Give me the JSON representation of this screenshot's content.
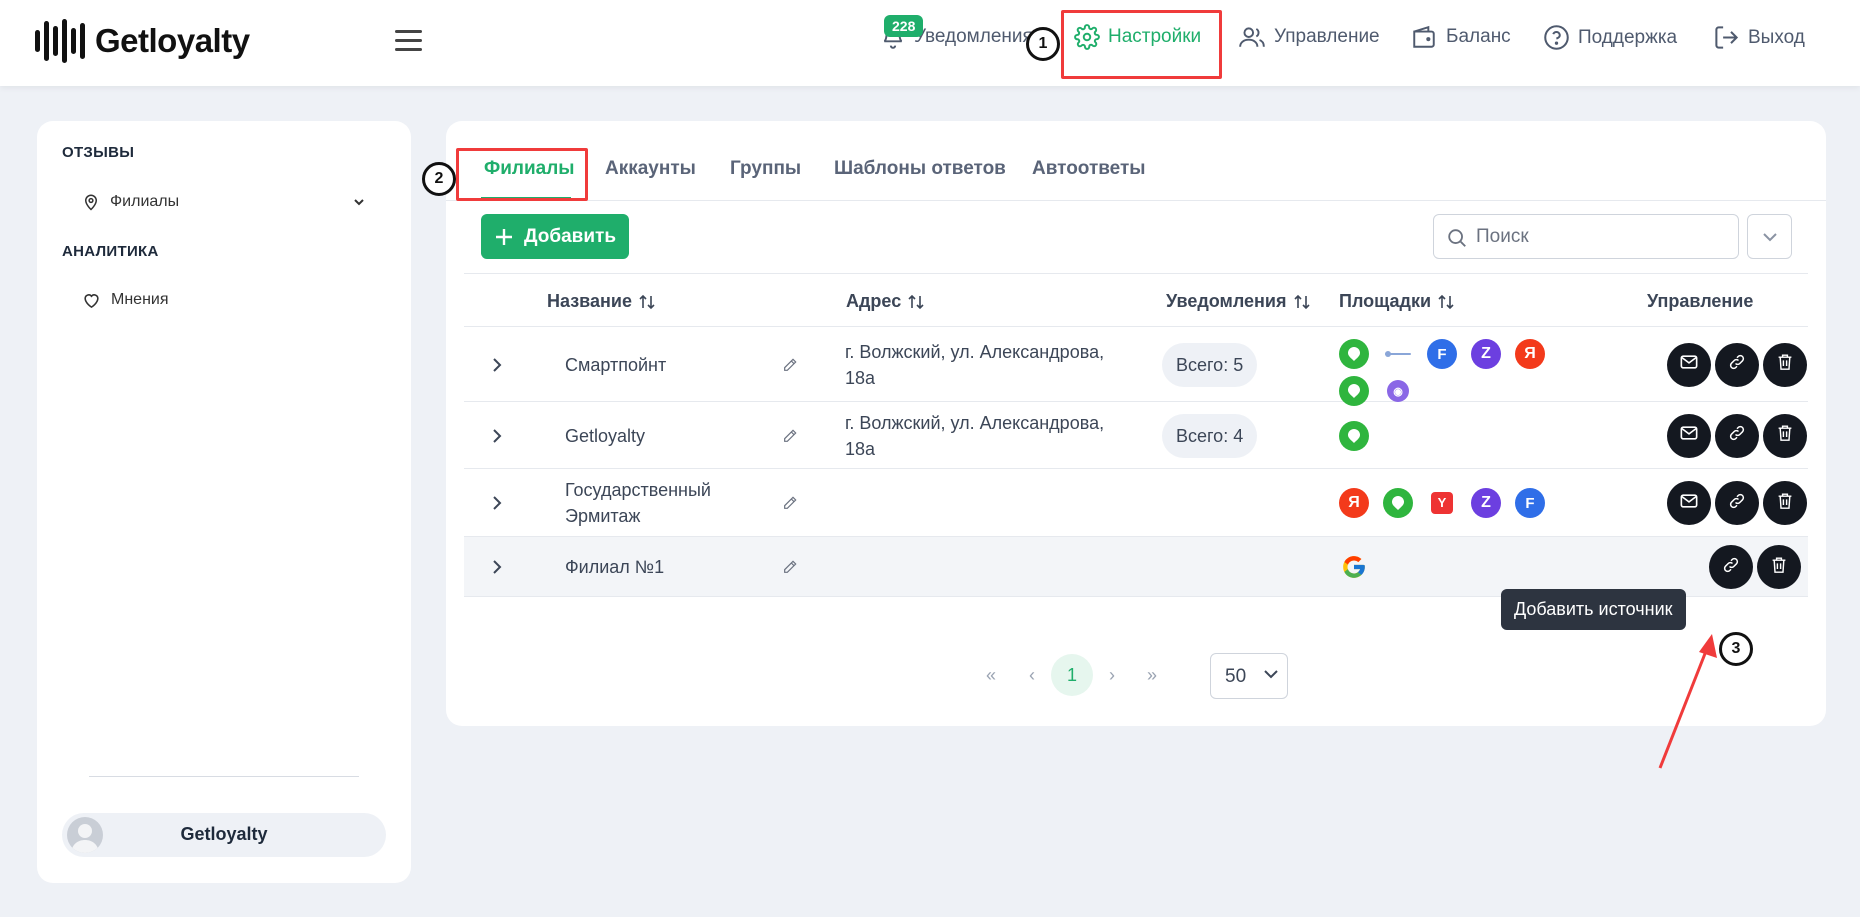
{
  "header": {
    "logo_text": "Getloyalty",
    "notifications_count": "228",
    "nav": {
      "notifications": "Уведомления",
      "settings": "Настройки",
      "manage": "Управление",
      "balance": "Баланс",
      "support": "Поддержка",
      "exit": "Выход"
    }
  },
  "annotations": {
    "step1": "1",
    "step2": "2",
    "step3": "3",
    "highlight_color": "#f03b3b"
  },
  "sidebar": {
    "section_reviews": "ОТЗЫВЫ",
    "item_branches": "Филиалы",
    "section_analytics": "АНАЛИТИКА",
    "item_opinions": "Мнения",
    "user_name": "Getloyalty"
  },
  "tabs": [
    "Филиалы",
    "Аккаунты",
    "Группы",
    "Шаблоны ответов",
    "Автоответы"
  ],
  "toolbar": {
    "add_label": "Добавить",
    "search_placeholder": "Поиск"
  },
  "table": {
    "columns": {
      "name": "Название",
      "address": "Адрес",
      "notifications": "Уведомления",
      "platforms": "Площадки",
      "manage": "Управление"
    },
    "rows": [
      {
        "name": [
          "Смартпойнт"
        ],
        "address": [
          "г. Волжский, ул. Александрова,",
          "18а"
        ],
        "notifications": "Всего: 5",
        "platforms": [
          "2gis",
          "zoon-small",
          "flamp",
          "zoon",
          "yandex",
          "2gis",
          "planet"
        ]
      },
      {
        "name": [
          "Getloyalty"
        ],
        "address": [
          "г. Волжский, ул. Александрова,",
          "18а"
        ],
        "notifications": "Всего: 4",
        "platforms": [
          "2gis"
        ]
      },
      {
        "name": [
          "Государственный",
          "Эрмитаж"
        ],
        "address": [],
        "notifications": "",
        "platforms": [
          "yandex",
          "2gis",
          "yell",
          "zoon",
          "flamp"
        ]
      },
      {
        "name": [
          "Филиал №1"
        ],
        "address": [],
        "notifications": "",
        "platforms": [
          "google"
        ]
      }
    ]
  },
  "tooltip": "Добавить источник",
  "pagination": {
    "current": "1",
    "per_page": "50"
  },
  "colors": {
    "accent": "#1fae6b",
    "dark_button": "#141820"
  }
}
